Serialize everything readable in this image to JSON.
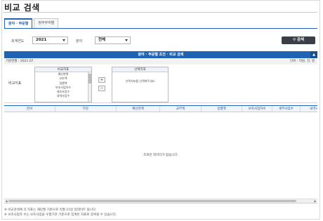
{
  "page": {
    "title": "비교 검색"
  },
  "tabs": [
    {
      "label": "분야 · 부문별",
      "active": true
    },
    {
      "label": "정부부처별",
      "active": false
    }
  ],
  "filters": {
    "year_label": "회계연도",
    "year_value": "2021",
    "field_label": "분야",
    "field_value": "전체",
    "search_label": "검색"
  },
  "panel": {
    "title": "분야 · 부문별 조건 · 비교 검색",
    "toggle": "▲",
    "base_date": "기준연월 : 2021.07",
    "unit": "단위 : 억원, 건, 명"
  },
  "items": {
    "label": "비교지표",
    "list_header": "비교지표",
    "list": [
      "예산현액",
      "교부액",
      "집행액",
      "보조사업자수",
      "세부사업수",
      "내역사업수"
    ],
    "add_btn": "+",
    "remove_btn": "−",
    "selected_header": "선택지표",
    "selected_empty": "선택지표를 선택해주세요"
  },
  "grid": {
    "columns": [
      "분야",
      "부문",
      "예산현액",
      "교부액",
      "집행액",
      "보조사업자수",
      "세부사업수",
      "내역사"
    ],
    "empty_text": "조회된 데이터가 없습니다.",
    "scroll_left": "◀",
    "scroll_right": "▶"
  },
  "notes": [
    "※ 비교검색에 각 지표는 해당월 기준으로 익월 15일 업데이트 됩니다.",
    "※ 보조사업자 수는 보조사업을 수행기관 기준으로 집계된 자료로 중복될 수 있습니다."
  ]
}
